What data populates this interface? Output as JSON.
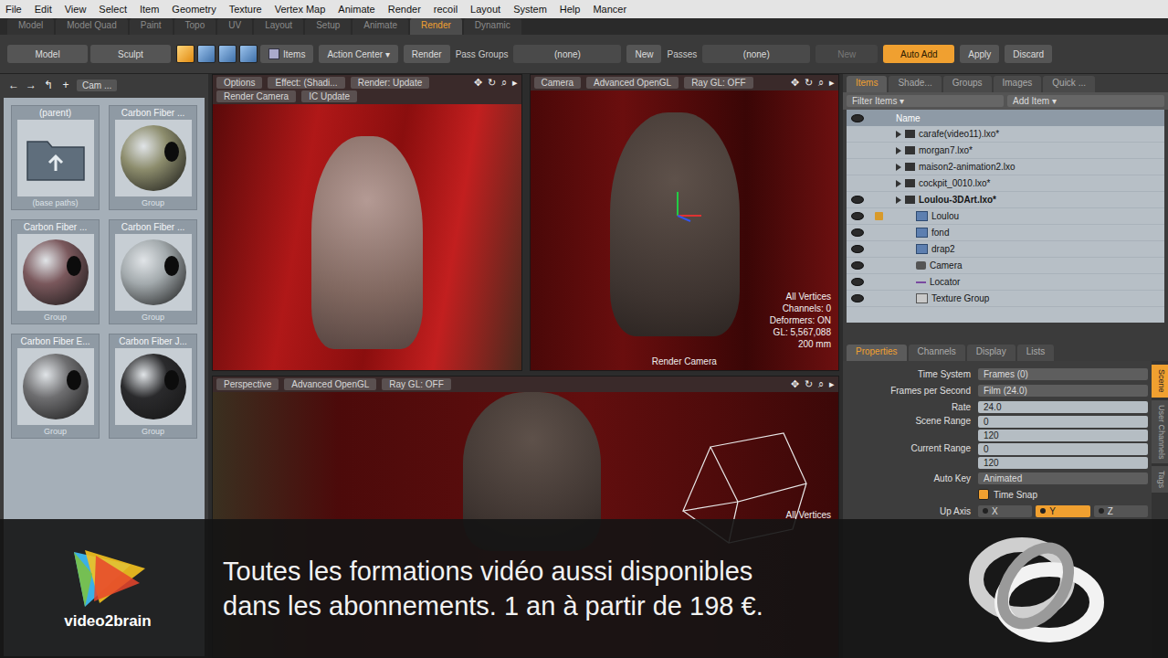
{
  "menu": [
    "File",
    "Edit",
    "View",
    "Select",
    "Item",
    "Geometry",
    "Texture",
    "Vertex Map",
    "Animate",
    "Render",
    "recoil",
    "Layout",
    "System",
    "Help",
    "Mancer"
  ],
  "layout_tabs": [
    {
      "label": "Model",
      "selected": false
    },
    {
      "label": "Model Quad",
      "selected": false
    },
    {
      "label": "Paint",
      "selected": false
    },
    {
      "label": "Topo",
      "selected": false
    },
    {
      "label": "UV",
      "selected": false
    },
    {
      "label": "Layout",
      "selected": false
    },
    {
      "label": "Setup",
      "selected": false
    },
    {
      "label": "Animate",
      "selected": false
    },
    {
      "label": "Render",
      "selected": true
    },
    {
      "label": "Dynamic",
      "selected": false
    }
  ],
  "toolbar": {
    "mode_buttons": [
      "Model",
      "Sculpt"
    ],
    "items_label": "Items",
    "action_center": "Action Center ▾",
    "render_button": "Render",
    "pass_groups_label": "Pass Groups",
    "pass_groups_value": "(none)",
    "new_button": "New",
    "passes_label": "Passes",
    "passes_value": "(none)",
    "new_disabled_button": "New",
    "auto_add": {
      "label": "Auto Add",
      "active": true
    },
    "apply": "Apply",
    "discard": "Discard"
  },
  "preset_browser": {
    "nav": [
      "←",
      "→",
      "↰",
      "+"
    ],
    "path": "Cam ...",
    "tiles": [
      {
        "title": "(parent)",
        "subtitle": "(base paths)",
        "kind": "folder",
        "color": "#5f6e7c"
      },
      {
        "title": "Carbon Fiber ...",
        "subtitle": "Group",
        "kind": "material",
        "color": "#8c8c6c"
      },
      {
        "title": "Carbon Fiber ...",
        "subtitle": "Group",
        "kind": "material",
        "color": "#7a585c"
      },
      {
        "title": "Carbon Fiber ...",
        "subtitle": "Group",
        "kind": "material",
        "color": "#a3aaad"
      },
      {
        "title": "Carbon Fiber E...",
        "subtitle": "Group",
        "kind": "material",
        "color": "#6e6e70"
      },
      {
        "title": "Carbon Fiber J...",
        "subtitle": "Group",
        "kind": "material",
        "color": "#2a2a2c"
      }
    ]
  },
  "viewports": {
    "render": {
      "buttons": [
        "Options",
        "Effect: (Shadi...",
        "Render: Update"
      ],
      "buttons2": [
        "Render Camera",
        "IC Update"
      ],
      "icons": [
        "✥",
        "↻",
        "⌕",
        "▸"
      ]
    },
    "camera": {
      "buttons": [
        "Camera",
        "Advanced OpenGL",
        "Ray GL: OFF"
      ],
      "icons": [
        "✥",
        "↻",
        "⌕",
        "▸"
      ],
      "info": [
        "All Vertices",
        "Channels: 0",
        "Deformers: ON",
        "GL: 5,567,088",
        "200 mm"
      ],
      "caption": "Render Camera"
    },
    "perspective": {
      "buttons": [
        "Perspective",
        "Advanced OpenGL",
        "Ray GL: OFF"
      ],
      "icons": [
        "✥",
        "↻",
        "⌕",
        "▸"
      ],
      "info": [
        "All Vertices"
      ]
    }
  },
  "items_panel": {
    "tabs": [
      {
        "label": "Items",
        "selected": true
      },
      {
        "label": "Shade...",
        "selected": false
      },
      {
        "label": "Groups",
        "selected": false
      },
      {
        "label": "Images",
        "selected": false
      },
      {
        "label": "Quick ...",
        "selected": false
      }
    ],
    "filter": "Filter Items ▾",
    "add_item": "Add Item ▾",
    "column": "Name",
    "rows": [
      {
        "label": "carafe(video11).lxo*",
        "level": 0,
        "bold": false,
        "visible": false,
        "locked": false,
        "kind": "scene"
      },
      {
        "label": "morgan7.lxo*",
        "level": 0,
        "bold": false,
        "visible": false,
        "locked": false,
        "kind": "scene"
      },
      {
        "label": "maison2-animation2.lxo",
        "level": 0,
        "bold": false,
        "visible": false,
        "locked": false,
        "kind": "scene"
      },
      {
        "label": "cockpit_0010.lxo*",
        "level": 0,
        "bold": false,
        "visible": false,
        "locked": false,
        "kind": "scene"
      },
      {
        "label": "Loulou-3DArt.lxo*",
        "level": 0,
        "bold": true,
        "visible": true,
        "locked": false,
        "kind": "scene"
      },
      {
        "label": "Loulou",
        "level": 1,
        "bold": false,
        "visible": true,
        "locked": true,
        "kind": "mesh"
      },
      {
        "label": "fond",
        "level": 1,
        "bold": false,
        "visible": true,
        "locked": false,
        "kind": "mesh"
      },
      {
        "label": "drap2",
        "level": 1,
        "bold": false,
        "visible": true,
        "locked": false,
        "kind": "mesh"
      },
      {
        "label": "Camera",
        "level": 1,
        "bold": false,
        "visible": true,
        "locked": false,
        "kind": "camera"
      },
      {
        "label": "Locator",
        "level": 1,
        "bold": false,
        "visible": true,
        "locked": false,
        "kind": "locator"
      },
      {
        "label": "Texture Group",
        "level": 1,
        "bold": false,
        "visible": true,
        "locked": false,
        "kind": "texture"
      }
    ]
  },
  "properties": {
    "tabs": [
      {
        "label": "Properties",
        "selected": true
      },
      {
        "label": "Channels",
        "selected": false
      },
      {
        "label": "Display",
        "selected": false
      },
      {
        "label": "Lists",
        "selected": false
      }
    ],
    "side_tabs": [
      {
        "label": "Scene",
        "selected": true
      },
      {
        "label": "User Channels",
        "selected": false
      },
      {
        "label": "Tags",
        "selected": false
      }
    ],
    "rows": [
      {
        "label": "Time System",
        "kind": "dropdown",
        "value": "Frames (0)"
      },
      {
        "label": "Frames per Second",
        "kind": "dropdown",
        "value": "Film (24.0)"
      },
      {
        "label": "Rate",
        "kind": "field",
        "value": "24.0"
      },
      {
        "label": "Scene Range",
        "kind": "range",
        "values": [
          "0",
          "120"
        ]
      },
      {
        "label": "Current Range",
        "kind": "range",
        "values": [
          "0",
          "120"
        ]
      },
      {
        "label": "Auto Key",
        "kind": "dropdown",
        "value": "Animated"
      },
      {
        "label": "Time Snap",
        "kind": "checkbox",
        "checked": true
      },
      {
        "label": "Up Axis",
        "kind": "axis",
        "options": [
          {
            "label": "X",
            "selected": false
          },
          {
            "label": "Y",
            "selected": true
          },
          {
            "label": "Z",
            "selected": false
          }
        ]
      }
    ]
  },
  "banner": {
    "brand": "video2brain",
    "lines": [
      "Toutes les formations vidéo aussi disponibles",
      "dans les abonnements. 1 an à partir de 198 €."
    ]
  }
}
